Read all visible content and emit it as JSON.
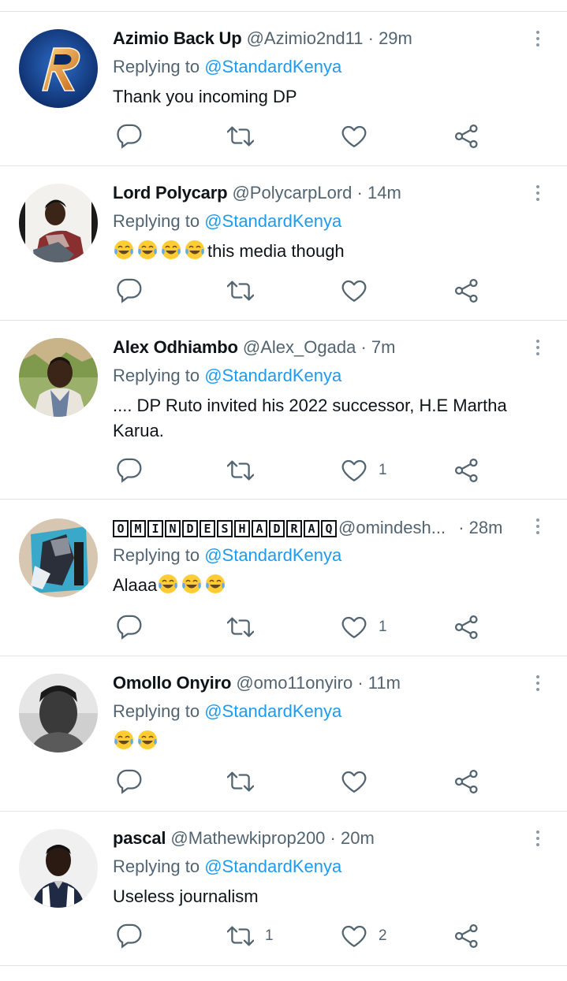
{
  "colors": {
    "link": "#1d9bf0",
    "muted": "#536471",
    "divider": "#e1e5e8"
  },
  "replying_label": "Replying to",
  "tweets": [
    {
      "name": "Azimio Back Up",
      "handle": "@Azimio2nd11",
      "time": "29m",
      "mention": "@StandardKenya",
      "text": "Thank you incoming DP",
      "reply_count": "",
      "retweet_count": "",
      "like_count": ""
    },
    {
      "name": "Lord Polycarp",
      "handle": "@PolycarpLord",
      "time": "14m",
      "mention": "@StandardKenya",
      "text": "this media though",
      "emoji_prefix": 4,
      "reply_count": "",
      "retweet_count": "",
      "like_count": ""
    },
    {
      "name": "Alex Odhiambo",
      "handle": "@Alex_Ogada",
      "time": "7m",
      "mention": "@StandardKenya",
      "text": ".... DP Ruto invited his 2022 successor, H.E Martha Karua.",
      "reply_count": "",
      "retweet_count": "",
      "like_count": "1"
    },
    {
      "name": "OMINDESHADRAQ",
      "name_letters": [
        "O",
        "M",
        "I",
        "N",
        "D",
        "E",
        "S",
        "H",
        "A",
        "D",
        "R",
        "A",
        "Q"
      ],
      "handle": "@omindesh...",
      "time": "28m",
      "mention": "@StandardKenya",
      "text": "Alaaa",
      "emoji_suffix": 3,
      "reply_count": "",
      "retweet_count": "",
      "like_count": "1"
    },
    {
      "name": "Omollo Onyiro",
      "handle": "@omo11onyiro",
      "time": "11m",
      "mention": "@StandardKenya",
      "text": "",
      "emoji_prefix": 2,
      "reply_count": "",
      "retweet_count": "",
      "like_count": ""
    },
    {
      "name": "pascal",
      "handle": "@Mathewkiprop200",
      "time": "20m",
      "mention": "@StandardKenya",
      "text": "Useless journalism",
      "reply_count": "",
      "retweet_count": "1",
      "like_count": "2"
    }
  ]
}
